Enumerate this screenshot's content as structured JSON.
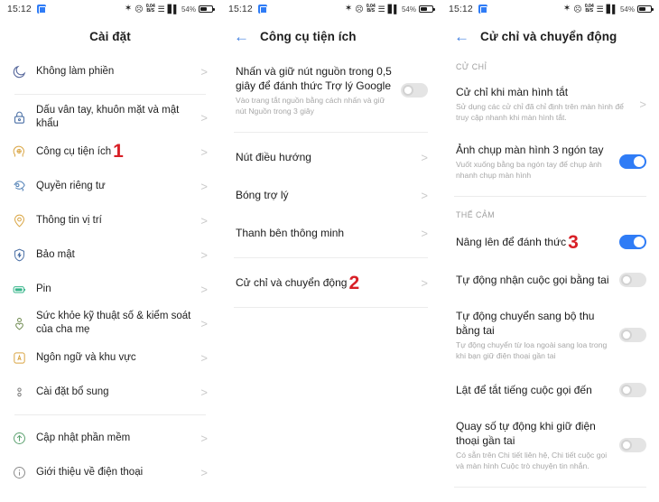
{
  "statusbar": {
    "time": "15:12",
    "battery_percent": "54%",
    "icons": [
      "bluetooth-icon",
      "mute-icon",
      "data-speed-icon",
      "wifi-icon",
      "signal-icon",
      "battery-icon"
    ]
  },
  "panel1": {
    "title": "Cài đặt",
    "items": [
      {
        "label": "Không làm phiền",
        "icon": "moon-icon",
        "color": "#5b6b9e",
        "chevron": ">"
      },
      {
        "divider": true
      },
      {
        "label": "Dấu vân tay, khuôn mặt và mật khẩu",
        "icon": "lock-icon",
        "color": "#4a6fa5",
        "chevron": ">"
      },
      {
        "label": "Công cụ tiện ích",
        "icon": "head-gear-icon",
        "color": "#d9a441",
        "chevron": ">",
        "badge": "1"
      },
      {
        "label": "Quyền riêng tư",
        "icon": "privacy-shield-icon",
        "color": "#4f7fb5",
        "chevron": ">"
      },
      {
        "label": "Thông tin vị trí",
        "icon": "location-pin-icon",
        "color": "#d9a441",
        "chevron": ">"
      },
      {
        "label": "Bảo mật",
        "icon": "shield-icon",
        "color": "#4a6fa5",
        "chevron": ">"
      },
      {
        "label": "Pin",
        "icon": "battery-icon",
        "color": "#35b58a",
        "chevron": ">"
      },
      {
        "label": "Sức khỏe kỹ thuật số & kiểm soát của cha mẹ",
        "icon": "parental-control-icon",
        "color": "#6e8a4f",
        "chevron": ">"
      },
      {
        "label": "Ngôn ngữ và khu vực",
        "icon": "language-icon",
        "color": "#d9a441",
        "chevron": ">"
      },
      {
        "label": "Cài đặt bổ sung",
        "icon": "more-settings-icon",
        "color": "#7b7b7b",
        "chevron": ">"
      },
      {
        "divider": true
      },
      {
        "label": "Cập nhật phần mềm",
        "icon": "update-icon",
        "color": "#5aa06e",
        "chevron": ">"
      },
      {
        "label": "Giới thiệu về điện thoại",
        "icon": "info-icon",
        "color": "#8a8a8a",
        "chevron": ">"
      }
    ]
  },
  "panel2": {
    "title": "Công cụ tiện ích",
    "back_icon": "back-arrow-icon",
    "items": [
      {
        "title": "Nhấn và giữ nút nguồn trong 0,5 giây để đánh thức Trợ lý Google",
        "sub": "Vào trang tắt nguồn bằng cách nhấn và giữ nút Nguồn trong 3 giây",
        "control": "toggle",
        "state": "off"
      },
      {
        "divider": true
      },
      {
        "title": "Nút điều hướng",
        "control": "chevron",
        "chevron": ">"
      },
      {
        "title": "Bóng trợ lý",
        "control": "chevron",
        "chevron": ">"
      },
      {
        "title": "Thanh bên thông minh",
        "control": "chevron",
        "chevron": ">"
      },
      {
        "divider": true
      },
      {
        "title": "Cử chỉ và chuyển động",
        "control": "chevron",
        "chevron": ">",
        "badge": "2"
      },
      {
        "divider": true
      }
    ]
  },
  "panel3": {
    "title": "Cử chỉ và chuyển động",
    "back_icon": "back-arrow-icon",
    "sections": [
      {
        "header": "CỬ CHỈ",
        "items": [
          {
            "title": "Cử chỉ khi màn hình tắt",
            "sub": "Sử dụng các cử chỉ đã chỉ định trên màn hình để truy cập nhanh khi màn hình tắt.",
            "control": "chevron",
            "chevron": ">"
          },
          {
            "title": "Ảnh chụp màn hình 3 ngón tay",
            "sub": "Vuốt xuống bằng ba ngón tay để chụp ảnh nhanh chụp màn hình",
            "control": "toggle",
            "state": "on"
          }
        ]
      },
      {
        "header": "THẾ CẢM",
        "items": [
          {
            "title": "Nâng lên để đánh thức",
            "control": "toggle",
            "state": "on",
            "badge": "3"
          },
          {
            "title": "Tự động nhận cuộc gọi bằng tai",
            "control": "toggle",
            "state": "off"
          },
          {
            "title": "Tự động chuyển sang bộ thu bằng tai",
            "sub": "Tự động chuyển từ loa ngoài sang loa trong khi bạn giữ điện thoại gần tai",
            "control": "toggle",
            "state": "off"
          },
          {
            "title": "Lật để tắt tiếng cuộc gọi đến",
            "control": "toggle",
            "state": "off"
          },
          {
            "title": "Quay số tự động khi giữ điện thoại gần tai",
            "sub": "Có sẵn trên Chi tiết liên hệ, Chi tiết cuộc gọi và màn hình Cuộc trò chuyện tin nhắn.",
            "control": "toggle",
            "state": "off"
          }
        ]
      }
    ]
  },
  "colors": {
    "accent_blue": "#2f7cf6",
    "badge_red": "#d81f26",
    "back_arrow_blue": "#3f7fe0",
    "chevron_gray": "#c9c9c9",
    "subtext_gray": "#a7a7a7"
  }
}
